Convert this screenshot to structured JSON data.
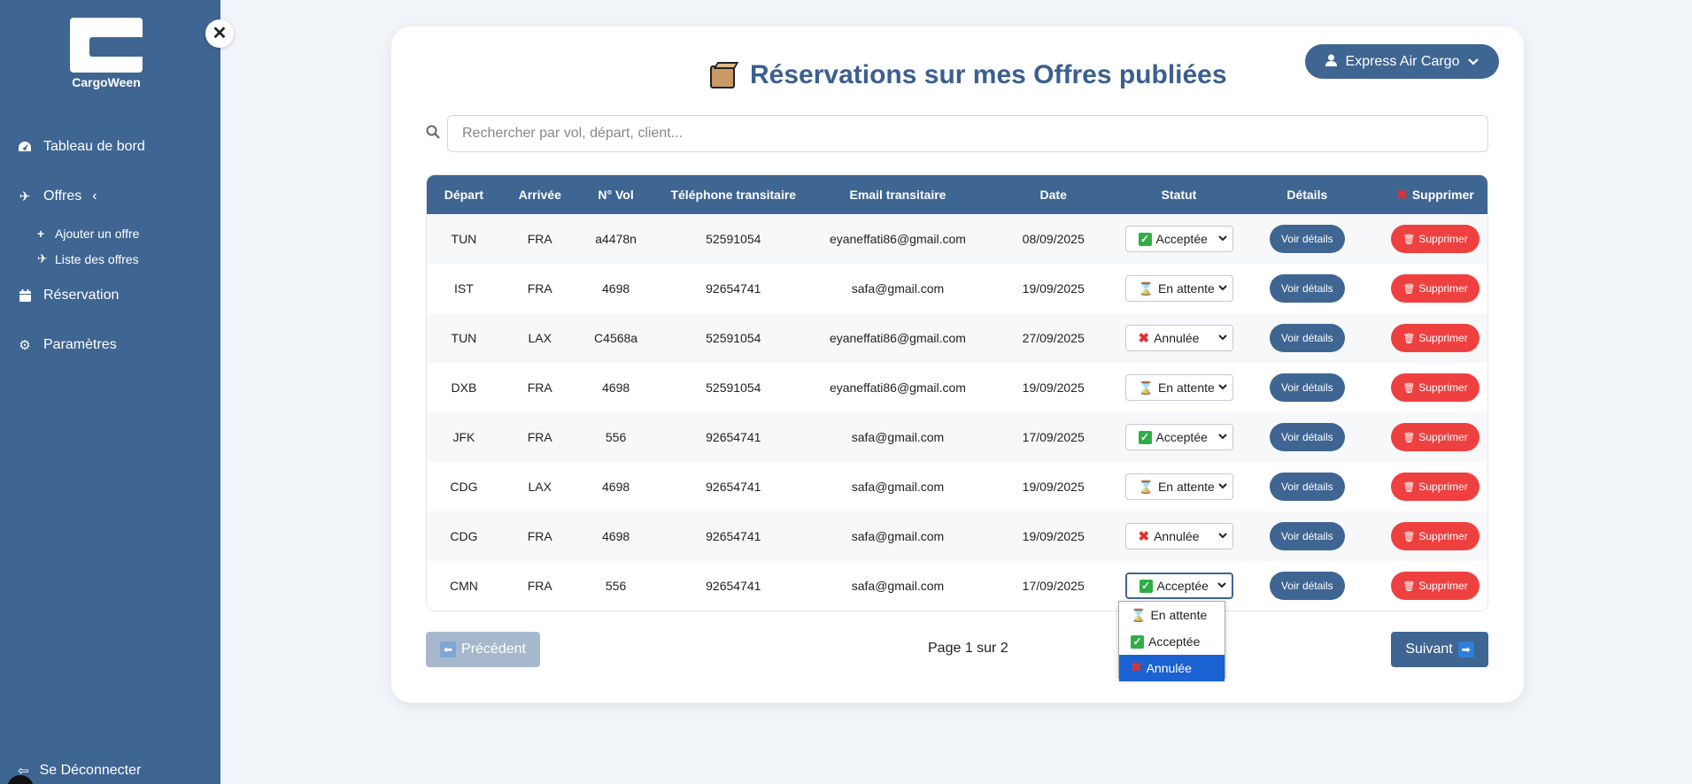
{
  "brand": {
    "name": "CargoWeen"
  },
  "sidebar": {
    "items": [
      {
        "label": "Tableau de bord",
        "icon": "dashboard-icon"
      },
      {
        "label": "Offres",
        "icon": "plane-icon"
      },
      {
        "label": "Réservation",
        "icon": "calendar-icon"
      },
      {
        "label": "Paramètres",
        "icon": "gear-icon"
      }
    ],
    "sub_items": [
      {
        "label": "Ajouter un offre",
        "icon": "plus-icon"
      },
      {
        "label": "Liste des offres",
        "icon": "plane-icon"
      }
    ],
    "logout": "Se Déconnecter"
  },
  "header": {
    "title": "Réservations sur mes Offres publiées",
    "user": "Express Air Cargo"
  },
  "search": {
    "placeholder": "Rechercher par vol, départ, client...",
    "value": ""
  },
  "table": {
    "headers": [
      "Départ",
      "Arrivée",
      "N° Vol",
      "Téléphone transitaire",
      "Email transitaire",
      "Date",
      "Statut",
      "Détails",
      "Supprimer"
    ],
    "rows": [
      {
        "depart": "TUN",
        "arrivee": "FRA",
        "vol": "a4478n",
        "tel": "52591054",
        "email": "eyaneffati86@gmail.com",
        "date": "08/09/2025",
        "statut": "Acceptée"
      },
      {
        "depart": "IST",
        "arrivee": "FRA",
        "vol": "4698",
        "tel": "92654741",
        "email": "safa@gmail.com",
        "date": "19/09/2025",
        "statut": "En attente"
      },
      {
        "depart": "TUN",
        "arrivee": "LAX",
        "vol": "C4568a",
        "tel": "52591054",
        "email": "eyaneffati86@gmail.com",
        "date": "27/09/2025",
        "statut": "Annulée"
      },
      {
        "depart": "DXB",
        "arrivee": "FRA",
        "vol": "4698",
        "tel": "52591054",
        "email": "eyaneffati86@gmail.com",
        "date": "19/09/2025",
        "statut": "En attente"
      },
      {
        "depart": "JFK",
        "arrivee": "FRA",
        "vol": "556",
        "tel": "92654741",
        "email": "safa@gmail.com",
        "date": "17/09/2025",
        "statut": "Acceptée"
      },
      {
        "depart": "CDG",
        "arrivee": "LAX",
        "vol": "4698",
        "tel": "92654741",
        "email": "safa@gmail.com",
        "date": "19/09/2025",
        "statut": "En attente"
      },
      {
        "depart": "CDG",
        "arrivee": "FRA",
        "vol": "4698",
        "tel": "92654741",
        "email": "safa@gmail.com",
        "date": "19/09/2025",
        "statut": "Annulée"
      },
      {
        "depart": "CMN",
        "arrivee": "FRA",
        "vol": "556",
        "tel": "92654741",
        "email": "safa@gmail.com",
        "date": "17/09/2025",
        "statut": "Acceptée"
      }
    ],
    "details_label": "Voir détails",
    "delete_label": "Supprimer"
  },
  "status_options": [
    "En attente",
    "Acceptée",
    "Annulée"
  ],
  "dropdown_highlighted": "Annulée",
  "pagination": {
    "prev": "Précédent",
    "next": "Suivant",
    "info": "Page 1 sur 2"
  },
  "colors": {
    "primary": "#3f6592",
    "danger": "#ef4040",
    "accepted": "#2fae45",
    "selected_option": "#1a62d1"
  }
}
